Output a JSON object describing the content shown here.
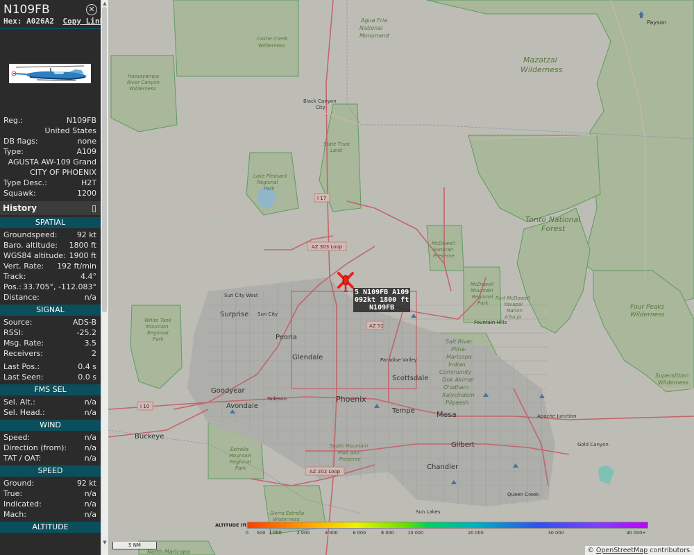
{
  "aircraft": {
    "callsign": "N109FB",
    "hex_label": "Hex:",
    "hex": "A026A2",
    "copy_link": "Copy Link",
    "close_icon": "close-circle-icon"
  },
  "info": [
    {
      "key": "Reg.:",
      "value": "N109FB"
    },
    {
      "key": "",
      "value": "United States"
    },
    {
      "key": "DB flags:",
      "value": "none"
    },
    {
      "key": "Type:",
      "value": "A109"
    },
    {
      "key": "",
      "value": "AGUSTA AW-109 Grand"
    },
    {
      "key": "",
      "value": "CITY OF PHOENIX"
    },
    {
      "key": "Type Desc.:",
      "value": "H2T"
    },
    {
      "key": "Squawk:",
      "value": "1200"
    }
  ],
  "history": {
    "label": "History",
    "icon": "expand-icon"
  },
  "sections": {
    "spatial": {
      "title": "SPATIAL",
      "rows": [
        {
          "key": "Groundspeed:",
          "value": "92 kt"
        },
        {
          "key": "Baro. altitude:",
          "value": "1800 ft"
        },
        {
          "key": "WGS84 altitude:",
          "value": "1900 ft"
        },
        {
          "key": "Vert. Rate:",
          "value": "192 ft/min"
        },
        {
          "key": "Track:",
          "value": "4.4°"
        },
        {
          "key": "Pos.:",
          "value": "33.705°, -112.083°"
        },
        {
          "key": "Distance:",
          "value": "n/a"
        }
      ]
    },
    "signal": {
      "title": "SIGNAL",
      "rows": [
        {
          "key": "Source:",
          "value": "ADS-B"
        },
        {
          "key": "RSSI:",
          "value": "-25.2"
        },
        {
          "key": "Msg. Rate:",
          "value": "3.5"
        },
        {
          "key": "Receivers:",
          "value": "2"
        },
        {
          "key": "Last Pos.:",
          "value": "0.4 s"
        },
        {
          "key": "Last Seen:",
          "value": "0.0 s"
        }
      ]
    },
    "fms": {
      "title": "FMS SEL",
      "rows": [
        {
          "key": "Sel. Alt.:",
          "value": "n/a"
        },
        {
          "key": "Sel. Head.:",
          "value": "n/a"
        }
      ]
    },
    "wind": {
      "title": "WIND",
      "rows": [
        {
          "key": "Speed:",
          "value": "n/a"
        },
        {
          "key": "Direction (from):",
          "value": "n/a"
        },
        {
          "key": "TAT / OAT:",
          "value": "n/a"
        }
      ]
    },
    "speed": {
      "title": "SPEED",
      "rows": [
        {
          "key": "Ground:",
          "value": "92 kt"
        },
        {
          "key": "True:",
          "value": "n/a"
        },
        {
          "key": "Indicated:",
          "value": "n/a"
        },
        {
          "key": "Mach:",
          "value": "n/a"
        }
      ]
    },
    "altitude": {
      "title": "ALTITUDE"
    }
  },
  "map": {
    "aircraft_label": [
      "5 N109FB A109",
      "092kt 1800 ft",
      "N109FB"
    ],
    "places": [
      "Payson",
      "Mazatzal",
      "Wilderness",
      "Agua Fria",
      "National",
      "Monument",
      "Castle Creek",
      "Wilderness",
      "Hassayampa",
      "River Canyon",
      "Wilderness",
      "Black Canyon",
      "City",
      "State Trust",
      "Land",
      "Lake Pleasant",
      "Regional",
      "Park",
      "I 17",
      "AZ 303 Loop",
      "Tonto National",
      "Forest",
      "McDowell",
      "Sonoran",
      "Preserve",
      "McDowell",
      "Mountain",
      "Regional",
      "Park",
      "Fort McDowell",
      "Yavapai",
      "Nation",
      "A'ba:ja",
      "Four Peaks",
      "Wilderness",
      "Sun City West",
      "Surprise",
      "Sun City",
      "AZ 51",
      "Fountain Hills",
      "White Tank",
      "Mountain",
      "Regional",
      "Park",
      "Peoria",
      "Glendale",
      "Paradise Valley",
      "Salt River",
      "Pima-",
      "Maricopa",
      "Indian",
      "Community",
      "Onk Akimel",
      "O'odham",
      "Xalychidom",
      "Piipaash",
      "Superstition",
      "Wilderness",
      "Scottsdale",
      "Goodyear",
      "Avondale",
      "Tolleson",
      "Phoenix",
      "I 10",
      "Tempe",
      "Mesa",
      "Apache Junction",
      "Buckeye",
      "Gilbert",
      "Gold Canyon",
      "South Mountain",
      "Park and",
      "Preserve",
      "Estrella",
      "Mountain",
      "Regional",
      "Park",
      "AZ 202 Loop",
      "Chandler",
      "Queen Creek",
      "Sun Lakes",
      "Sierra Estrella",
      "Wilderness",
      "North Maricopa"
    ],
    "altitude_legend": {
      "title": "ALTITUDE (ft)",
      "ticks": [
        "0",
        "500",
        "1 000",
        "2 000",
        "4 000",
        "6 000",
        "8 000",
        "10 000",
        "20 000",
        "30 000",
        "40 000+"
      ]
    },
    "scale": "5 NM",
    "attribution": {
      "prefix": "©",
      "link": "OpenStreetMap",
      "suffix": "contributors."
    },
    "colors": {
      "aircraft": "#e8231e",
      "sidebar": "#2b2b2b",
      "section": "#0b4f5c"
    }
  }
}
